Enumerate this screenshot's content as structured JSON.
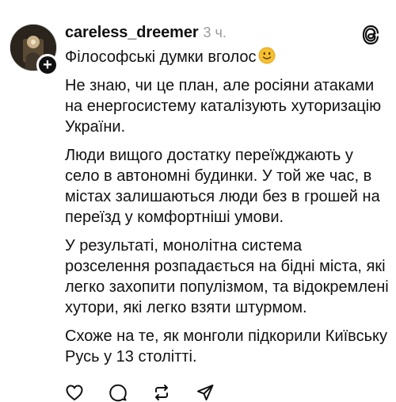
{
  "post": {
    "username": "careless_dreemer",
    "time": "3 ч.",
    "paragraphs": [
      "Філософські думки вголос",
      "Не знаю, чи це план, але росіяни атаками на енергосистему каталізують хуторизацію України.",
      "Люди вищого достатку переїжджають у село в автономні будинки. У той же час, в містах залишаються люди без в грошей на переїзд у комфортніші умови.",
      "У результаті, монолітна система розселення розпадається на бідні міста, які легко захопити популізмом, та відокремлені хутори, які легко взяти штурмом.",
      "Схоже на те, як монголи підкорили Київську Русь у 13 столітті."
    ],
    "emoji": "slightly-smiling-face-emoji"
  },
  "icons": {
    "avatar": "avatar",
    "follow": "plus-icon",
    "brand": "threads-logo-icon",
    "actions": [
      "heart-icon",
      "comment-icon",
      "repost-icon",
      "share-icon"
    ]
  },
  "colors": {
    "text": "#111111",
    "muted": "#9a9a9a",
    "emoji": "#f7c02f"
  }
}
